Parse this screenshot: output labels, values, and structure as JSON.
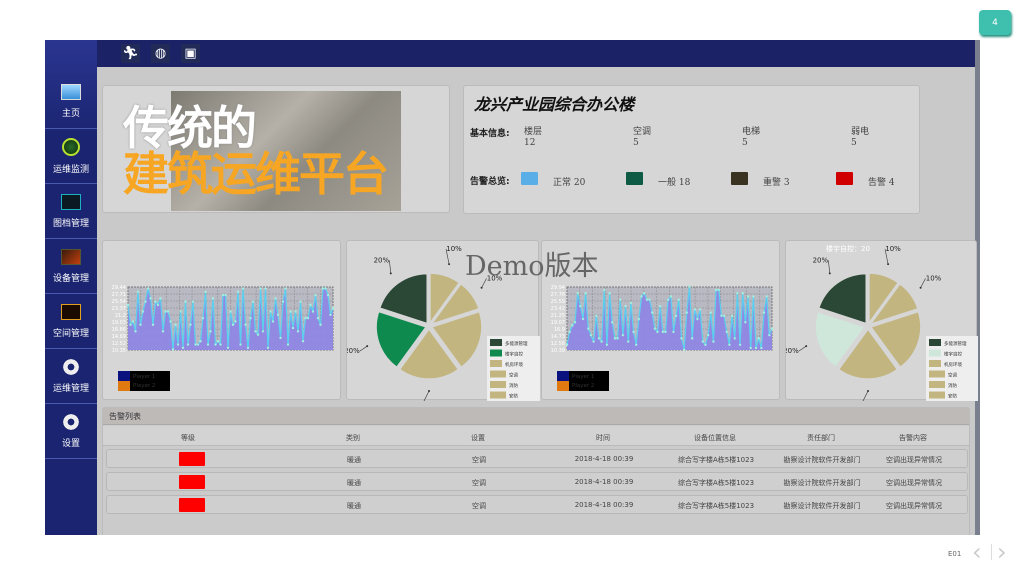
{
  "page_badge": "4",
  "footer": {
    "code": "E01",
    "prev": "‹",
    "next": "›"
  },
  "watermark": "Demo版本",
  "topbar": {
    "icons": [
      "running-man-icon",
      "globe-icon",
      "box-icon"
    ]
  },
  "sidebar": {
    "items": [
      {
        "label": "主页",
        "icon": "monitor-icon"
      },
      {
        "label": "运维监测",
        "icon": "radar-icon"
      },
      {
        "label": "图档管理",
        "icon": "blueprint-icon"
      },
      {
        "label": "设备管理",
        "icon": "device-icon"
      },
      {
        "label": "空间管理",
        "icon": "space-icon"
      },
      {
        "label": "运维管理",
        "icon": "gear-icon"
      },
      {
        "label": "设置",
        "icon": "gear-icon"
      }
    ]
  },
  "banner": {
    "line1": "传统的",
    "line2": "建筑运维平台"
  },
  "info": {
    "title": "龙兴产业园综合办公楼",
    "basic_label": "基本信息:",
    "basic": [
      {
        "name": "楼层",
        "value": "12"
      },
      {
        "name": "空调",
        "value": "5"
      },
      {
        "name": "电梯",
        "value": "5"
      },
      {
        "name": "弱电",
        "value": "5"
      }
    ],
    "alarm_label": "告警总览:",
    "alarms": [
      {
        "label": "正常 20",
        "color": "#5aaee8"
      },
      {
        "label": "一般 18",
        "color": "#0d5a45"
      },
      {
        "label": "重警 3",
        "color": "#3a3322"
      },
      {
        "label": "告警 4",
        "color": "#d10000"
      }
    ]
  },
  "chart_data": [
    {
      "type": "area",
      "title": "",
      "legend": [
        "Player 1",
        "Player 2"
      ],
      "yticks": [
        "29.44",
        "27.71",
        "25.54",
        "23.37",
        "21.2",
        "19.03",
        "16.86",
        "14.69",
        "12.52",
        "10.35"
      ],
      "ylim": [
        10.35,
        29.44
      ],
      "values": [
        24,
        18,
        19,
        16,
        28,
        18,
        22,
        25,
        29,
        26,
        18,
        25,
        24,
        26,
        16,
        22,
        22,
        19,
        10.5,
        18,
        12,
        22,
        11,
        25,
        12,
        18,
        25,
        12,
        12,
        13,
        20,
        28,
        12,
        16,
        26,
        12,
        13,
        12,
        27,
        27,
        11,
        22,
        18,
        19,
        28,
        12,
        29,
        18,
        11,
        20,
        25,
        16,
        15,
        29,
        16,
        29,
        11,
        22,
        19,
        26,
        21,
        14,
        25,
        29,
        12,
        22,
        17,
        22,
        16,
        25,
        13,
        20,
        20,
        24,
        22,
        27,
        20,
        18,
        29,
        29,
        27,
        21,
        23
      ]
    },
    {
      "type": "pie",
      "title": "",
      "legend": [
        "多能源管理",
        "楼宇自控",
        "机房环境",
        "空调",
        "消防",
        "安防"
      ],
      "slices": [
        {
          "label": "安防",
          "value": 10
        },
        {
          "label": "消防",
          "value": 10
        },
        {
          "label": "空调",
          "value": 20
        },
        {
          "label": "机房环境",
          "value": 20
        },
        {
          "label": "楼宇自控",
          "value": 20
        },
        {
          "label": "多能源管理",
          "value": 20
        }
      ],
      "colors": {
        "多能源管理": "#2b4736",
        "楼宇自控": "#0f8a4f",
        "机房环境": "#c2b580",
        "空调": "#c2b580",
        "消防": "#c2b580",
        "安防": "#c2b580"
      }
    },
    {
      "type": "area",
      "title": "",
      "legend": [
        "Player 1",
        "Player 2"
      ],
      "yticks": [
        "29.94",
        "27.76",
        "25.59",
        "23.42",
        "21.25",
        "19.07",
        "16.9",
        "14.73",
        "12.56",
        "10.39"
      ],
      "ylim": [
        10.39,
        29.94
      ],
      "values": [
        12,
        16,
        18,
        19,
        28,
        24,
        20,
        28,
        17,
        15,
        13,
        21,
        14,
        13,
        29,
        12,
        28,
        19,
        14,
        14,
        26,
        15,
        24,
        13,
        25,
        16,
        12,
        20,
        27,
        28,
        26,
        26,
        22,
        17,
        16,
        24,
        16,
        16,
        26,
        27,
        16,
        21,
        26,
        14,
        10.5,
        22,
        30,
        14,
        23,
        20,
        23,
        13,
        12,
        15,
        22,
        13,
        29,
        29,
        21,
        21,
        16,
        12,
        21,
        14,
        28,
        12,
        28,
        19,
        27,
        11,
        27,
        11,
        14,
        11,
        22,
        27,
        15,
        17
      ]
    },
    {
      "type": "pie",
      "title": "楼宇自控：20",
      "legend": [
        "多能源管理",
        "楼宇自控",
        "机房环境",
        "空调",
        "消防",
        "安防"
      ],
      "slices": [
        {
          "label": "安防",
          "value": 10
        },
        {
          "label": "消防",
          "value": 10
        },
        {
          "label": "空调",
          "value": 20
        },
        {
          "label": "机房环境",
          "value": 20
        },
        {
          "label": "楼宇自控",
          "value": 20
        },
        {
          "label": "多能源管理",
          "value": 20
        }
      ],
      "colors": {
        "多能源管理": "#2b4736",
        "楼宇自控": "#cfe6da",
        "机房环境": "#c2b580",
        "空调": "#c2b580",
        "消防": "#c2b580",
        "安防": "#c2b580"
      }
    }
  ],
  "alarm_table": {
    "title": "告警列表",
    "columns": [
      "等级",
      "类别",
      "设置",
      "时间",
      "设备位置信息",
      "责任部门",
      "告警内容"
    ],
    "rows": [
      {
        "level_color": "#ff0000",
        "category": "暖通",
        "device": "空调",
        "time": "2018-4-18  00:39",
        "location": "综合写字楼A栋5楼1023",
        "dept": "勘察设计院软件开发部门",
        "content": "空调出现异常情况"
      },
      {
        "level_color": "#ff0000",
        "category": "暖通",
        "device": "空调",
        "time": "2018-4-18  00:39",
        "location": "综合写字楼A栋5楼1023",
        "dept": "勘察设计院软件开发部门",
        "content": "空调出现异常情况"
      },
      {
        "level_color": "#ff0000",
        "category": "暖通",
        "device": "空调",
        "time": "2018-4-18  00:39",
        "location": "综合写字楼A栋5楼1023",
        "dept": "勘察设计院软件开发部门",
        "content": "空调出现异常情况"
      }
    ]
  }
}
